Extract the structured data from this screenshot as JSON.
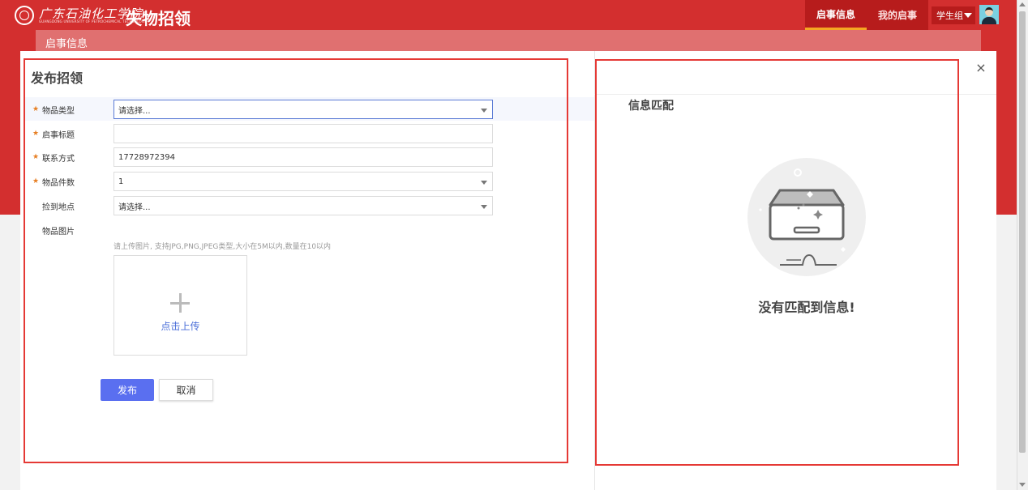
{
  "header": {
    "school_name": "广东石油化工学院",
    "school_sub": "GUANGDONG UNIVERSITY OF PETROCHEMICAL TECHNOLOGY",
    "app_title": "失物招领",
    "nav": [
      {
        "label": "启事信息",
        "active": true
      },
      {
        "label": "我的启事",
        "active": false
      }
    ],
    "user_label": "学生组"
  },
  "breadcrumb": "启事信息",
  "form": {
    "title": "发布招领",
    "fields": [
      {
        "label": "物品类型",
        "required": true,
        "value": "请选择...",
        "type": "select"
      },
      {
        "label": "启事标题",
        "required": true,
        "value": "",
        "type": "text"
      },
      {
        "label": "联系方式",
        "required": true,
        "value": "17728972394",
        "type": "text"
      },
      {
        "label": "物品件数",
        "required": true,
        "value": "1",
        "type": "select"
      },
      {
        "label": "捡到地点",
        "required": false,
        "value": "请选择...",
        "type": "select"
      },
      {
        "label": "物品图片",
        "required": false,
        "value": "",
        "type": "upload"
      }
    ],
    "upload_hint": "请上传图片, 支持JPG,PNG,JPEG类型,大小在5M以内,数量在10以内",
    "upload_label": "点击上传",
    "submit_label": "发布",
    "cancel_label": "取消"
  },
  "match": {
    "title": "信息匹配",
    "empty_text": "没有匹配到信息!"
  },
  "close_symbol": "×",
  "colors": {
    "primary_red": "#d32f2f",
    "accent_blue": "#5a6ff0",
    "required_star": "#e67e22",
    "highlight_border": "#e53935"
  }
}
